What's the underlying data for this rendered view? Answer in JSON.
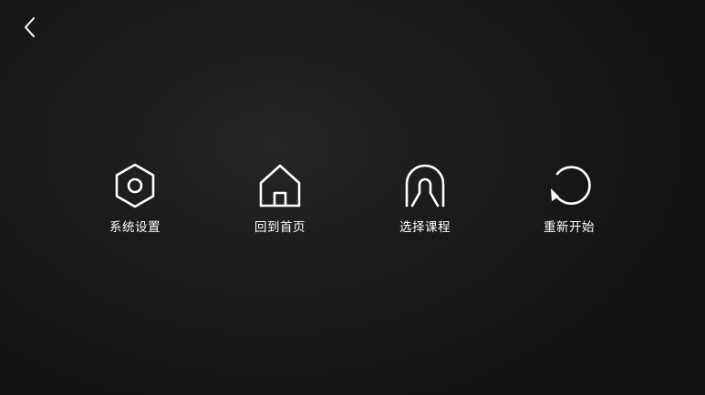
{
  "header": {
    "back_icon": "chevron-left-icon"
  },
  "menu": {
    "items": [
      {
        "label": "系统设置",
        "icon": "hexagon-settings-icon"
      },
      {
        "label": "回到首页",
        "icon": "home-icon"
      },
      {
        "label": "选择课程",
        "icon": "arch-course-icon"
      },
      {
        "label": "重新开始",
        "icon": "restart-icon"
      }
    ]
  },
  "colors": {
    "background": "#1a1a1a",
    "foreground": "#ffffff"
  }
}
